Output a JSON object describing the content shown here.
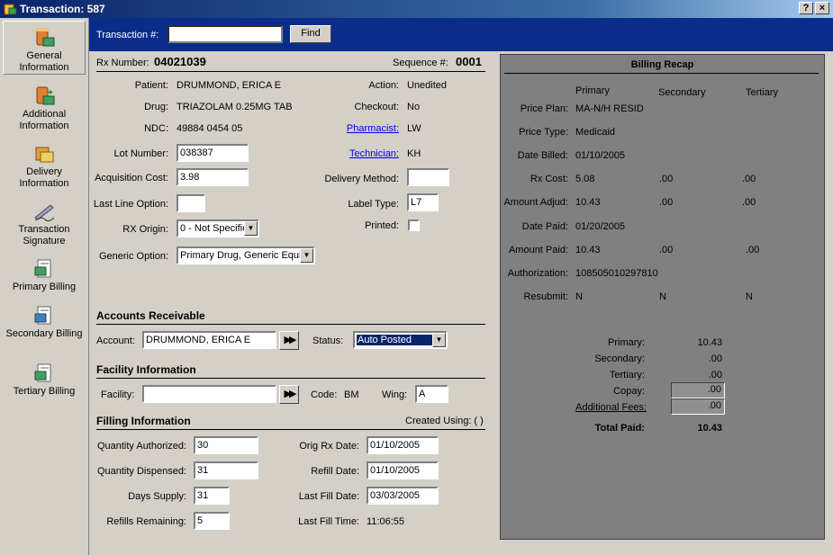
{
  "window": {
    "title": "Transaction: 587",
    "help_btn": "?",
    "close_btn": "×"
  },
  "sidebar": {
    "items": [
      {
        "label": "General Information",
        "icon": "general-info-icon",
        "active": true
      },
      {
        "label": "Additional Information",
        "icon": "additional-info-icon"
      },
      {
        "label": "Delivery Information",
        "icon": "delivery-info-icon"
      },
      {
        "label": "Transaction Signature",
        "icon": "signature-icon"
      },
      {
        "label": "Primary Billing",
        "icon": "primary-billing-icon"
      },
      {
        "label": "Secondary Billing",
        "icon": "secondary-billing-icon"
      },
      {
        "label": "Tertiary Billing",
        "icon": "tertiary-billing-icon"
      }
    ]
  },
  "search": {
    "label": "Transaction #:",
    "value": "",
    "find_button": "Find"
  },
  "header": {
    "rx_label": "Rx Number:",
    "rx_value": "04021039",
    "seq_label": "Sequence #:",
    "seq_value": "0001"
  },
  "general": {
    "patient_label": "Patient:",
    "patient": "DRUMMOND, ERICA E",
    "drug_label": "Drug:",
    "drug": "TRIAZOLAM 0.25MG TAB",
    "ndc_label": "NDC:",
    "ndc": "49884 0454 05",
    "lot_label": "Lot Number:",
    "lot": "038387",
    "acq_label": "Acquisition Cost:",
    "acq": "3.98",
    "last_line_label": "Last Line Option:",
    "last_line": "",
    "rx_origin_label": "RX Origin:",
    "rx_origin": "0 - Not Specifie",
    "generic_label": "Generic Option:",
    "generic": "Primary Drug, Generic Equiv",
    "action_label": "Action:",
    "action": "Unedited",
    "checkout_label": "Checkout:",
    "checkout": "No",
    "pharmacist_label": "Pharmacist:",
    "pharmacist": "LW",
    "technician_label": "Technician:",
    "technician": "KH",
    "delivery_label": "Delivery Method:",
    "delivery": "",
    "label_type_label": "Label Type:",
    "label_type": "L7",
    "printed_label": "Printed:",
    "printed": false
  },
  "ar": {
    "title": "Accounts Receivable",
    "account_label": "Account:",
    "account": "DRUMMOND, ERICA E",
    "status_label": "Status:",
    "status": "Auto Posted"
  },
  "facility": {
    "title": "Facility Information",
    "facility_label": "Facility:",
    "facility": "",
    "code_label": "Code:",
    "code": "BM",
    "wing_label": "Wing:",
    "wing": "A"
  },
  "filling": {
    "title": "Filling Information",
    "created_using": "Created Using: ( )",
    "qty_auth_label": "Quantity Authorized:",
    "qty_auth": "30",
    "qty_disp_label": "Quantity Dispensed:",
    "qty_disp": "31",
    "days_label": "Days Supply:",
    "days": "31",
    "refills_label": "Refills Remaining:",
    "refills": "5",
    "orig_label": "Orig Rx Date:",
    "orig": "01/10/2005",
    "refill_label": "Refill Date:",
    "refill": "01/10/2005",
    "last_fill_label": "Last Fill Date:",
    "last_fill": "03/03/2005",
    "last_fill_time_label": "Last Fill Time:",
    "last_fill_time": "11:06:55"
  },
  "recap": {
    "title": "Billing Recap",
    "col_primary": "Primary",
    "col_secondary": "Secondary",
    "col_tertiary": "Tertiary",
    "price_plan_label": "Price Plan:",
    "price_plan": "MA-N/H RESID",
    "price_type_label": "Price Type:",
    "price_type": "Medicaid",
    "date_billed_label": "Date Billed:",
    "date_billed": "01/10/2005",
    "rx_cost_label": "Rx Cost:",
    "rx_cost": [
      "5.08",
      ".00",
      ".00"
    ],
    "amt_adjud_label": "Amount Adjud:",
    "amt_adjud": [
      "10.43",
      ".00",
      ".00"
    ],
    "date_paid_label": "Date Paid:",
    "date_paid": "01/20/2005",
    "amt_paid_label": "Amount Paid:",
    "amt_paid": [
      "10.43",
      ".00",
      ".00"
    ],
    "auth_label": "Authorization:",
    "auth": "108505010297810",
    "resubmit_label": "Resubmit:",
    "resubmit": [
      "N",
      "N",
      "N"
    ],
    "sum_primary_label": "Primary:",
    "sum_primary": "10.43",
    "sum_secondary_label": "Secondary:",
    "sum_secondary": ".00",
    "sum_tertiary_label": "Tertiary:",
    "sum_tertiary": ".00",
    "copay_label": "Copay:",
    "copay": ".00",
    "fees_label": "Additional Fees:",
    "fees": ".00",
    "total_label": "Total Paid:",
    "total": "10.43"
  }
}
